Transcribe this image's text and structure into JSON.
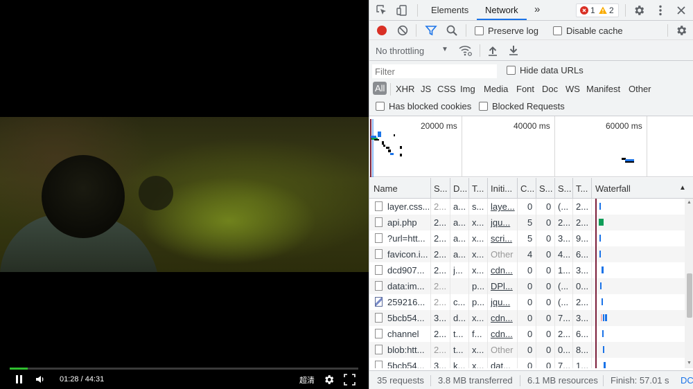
{
  "player": {
    "time_display": "01:28 / 44:31",
    "quality_label": "超清",
    "progress_fraction": 0.052,
    "accent_color": "#2fbf2f"
  },
  "devtools": {
    "tabs": [
      {
        "label": "Elements",
        "active": false
      },
      {
        "label": "Network",
        "active": true
      }
    ],
    "more_tabs_icon": "chevron-double-right-icon",
    "error_count": "1",
    "warning_count": "2",
    "toolbar": {
      "preserve_log_label": "Preserve log",
      "disable_cache_label": "Disable cache",
      "throttling_value": "No throttling"
    },
    "filter": {
      "placeholder": "Filter",
      "hide_data_urls_label": "Hide data URLs",
      "types": [
        "All",
        "XHR",
        "JS",
        "CSS",
        "Img",
        "Media",
        "Font",
        "Doc",
        "WS",
        "Manifest",
        "Other"
      ],
      "active_type": "All",
      "has_blocked_cookies_label": "Has blocked cookies",
      "blocked_requests_label": "Blocked Requests"
    },
    "overview": {
      "tick_labels": [
        "20000 ms",
        "40000 ms",
        "60000 ms"
      ]
    },
    "table": {
      "headers": [
        "Name",
        "S...",
        "D...",
        "T...",
        "Initi...",
        "C...",
        "S...",
        "S...",
        "T...",
        "Waterfall"
      ],
      "rows": [
        {
          "name": "layer.css...",
          "status": "2...",
          "domain": "a...",
          "type": "s...",
          "initiator": "laye...",
          "c": "0",
          "s": "0",
          "size": "(...",
          "time": "2...",
          "icon": "doc",
          "dim_status": true,
          "initiator_link": true
        },
        {
          "name": "api.php",
          "status": "2...",
          "domain": "a...",
          "type": "x...",
          "initiator": "jqu...",
          "c": "5",
          "s": "0",
          "size": "2...",
          "time": "2...",
          "icon": "doc",
          "dim_status": false,
          "initiator_link": true
        },
        {
          "name": "?url=htt...",
          "status": "2...",
          "domain": "a...",
          "type": "x...",
          "initiator": "scri...",
          "c": "5",
          "s": "0",
          "size": "3...",
          "time": "9...",
          "icon": "doc",
          "dim_status": false,
          "initiator_link": true
        },
        {
          "name": "favicon.i...",
          "status": "2...",
          "domain": "a...",
          "type": "x...",
          "initiator": "Other",
          "c": "4",
          "s": "0",
          "size": "4...",
          "time": "6...",
          "icon": "doc",
          "dim_status": false,
          "initiator_link": false
        },
        {
          "name": "dcd907...",
          "status": "2...",
          "domain": "j...",
          "type": "x...",
          "initiator": "cdn...",
          "c": "0",
          "s": "0",
          "size": "1...",
          "time": "3...",
          "icon": "doc",
          "dim_status": false,
          "initiator_link": true
        },
        {
          "name": "data:im...",
          "status": "2...",
          "domain": "",
          "type": "p...",
          "initiator": "DPl...",
          "c": "0",
          "s": "0",
          "size": "(...",
          "time": "0...",
          "icon": "doc",
          "dim_status": true,
          "initiator_link": true
        },
        {
          "name": "259216...",
          "status": "2...",
          "domain": "c...",
          "type": "p...",
          "initiator": "jqu...",
          "c": "0",
          "s": "0",
          "size": "(...",
          "time": "2...",
          "icon": "img",
          "dim_status": true,
          "initiator_link": true
        },
        {
          "name": "5bcb54...",
          "status": "3...",
          "domain": "d...",
          "type": "x...",
          "initiator": "cdn...",
          "c": "0",
          "s": "0",
          "size": "7...",
          "time": "3...",
          "icon": "doc",
          "dim_status": false,
          "initiator_link": true
        },
        {
          "name": "channel",
          "status": "2...",
          "domain": "t...",
          "type": "f...",
          "initiator": "cdn...",
          "c": "0",
          "s": "0",
          "size": "2...",
          "time": "6...",
          "icon": "doc",
          "dim_status": false,
          "initiator_link": true
        },
        {
          "name": "blob:htt...",
          "status": "2...",
          "domain": "t...",
          "type": "x...",
          "initiator": "Other",
          "c": "0",
          "s": "0",
          "size": "0...",
          "time": "8...",
          "icon": "doc",
          "dim_status": true,
          "initiator_link": false
        },
        {
          "name": "5bcb54...",
          "status": "3...",
          "domain": "k...",
          "type": "x...",
          "initiator": "dat...",
          "c": "0",
          "s": "0",
          "size": "7...",
          "time": "1...",
          "icon": "doc",
          "dim_status": false,
          "initiator_link": true
        }
      ]
    },
    "status": {
      "requests": "35 requests",
      "transferred": "3.8 MB transferred",
      "resources": "6.1 MB resources",
      "finish": "Finish: 57.01 s",
      "dcl": "DC"
    },
    "colors": {
      "record_red": "#d93025",
      "accent_blue": "#1a73e8",
      "waterfall_line": "#7b1e3a"
    }
  }
}
